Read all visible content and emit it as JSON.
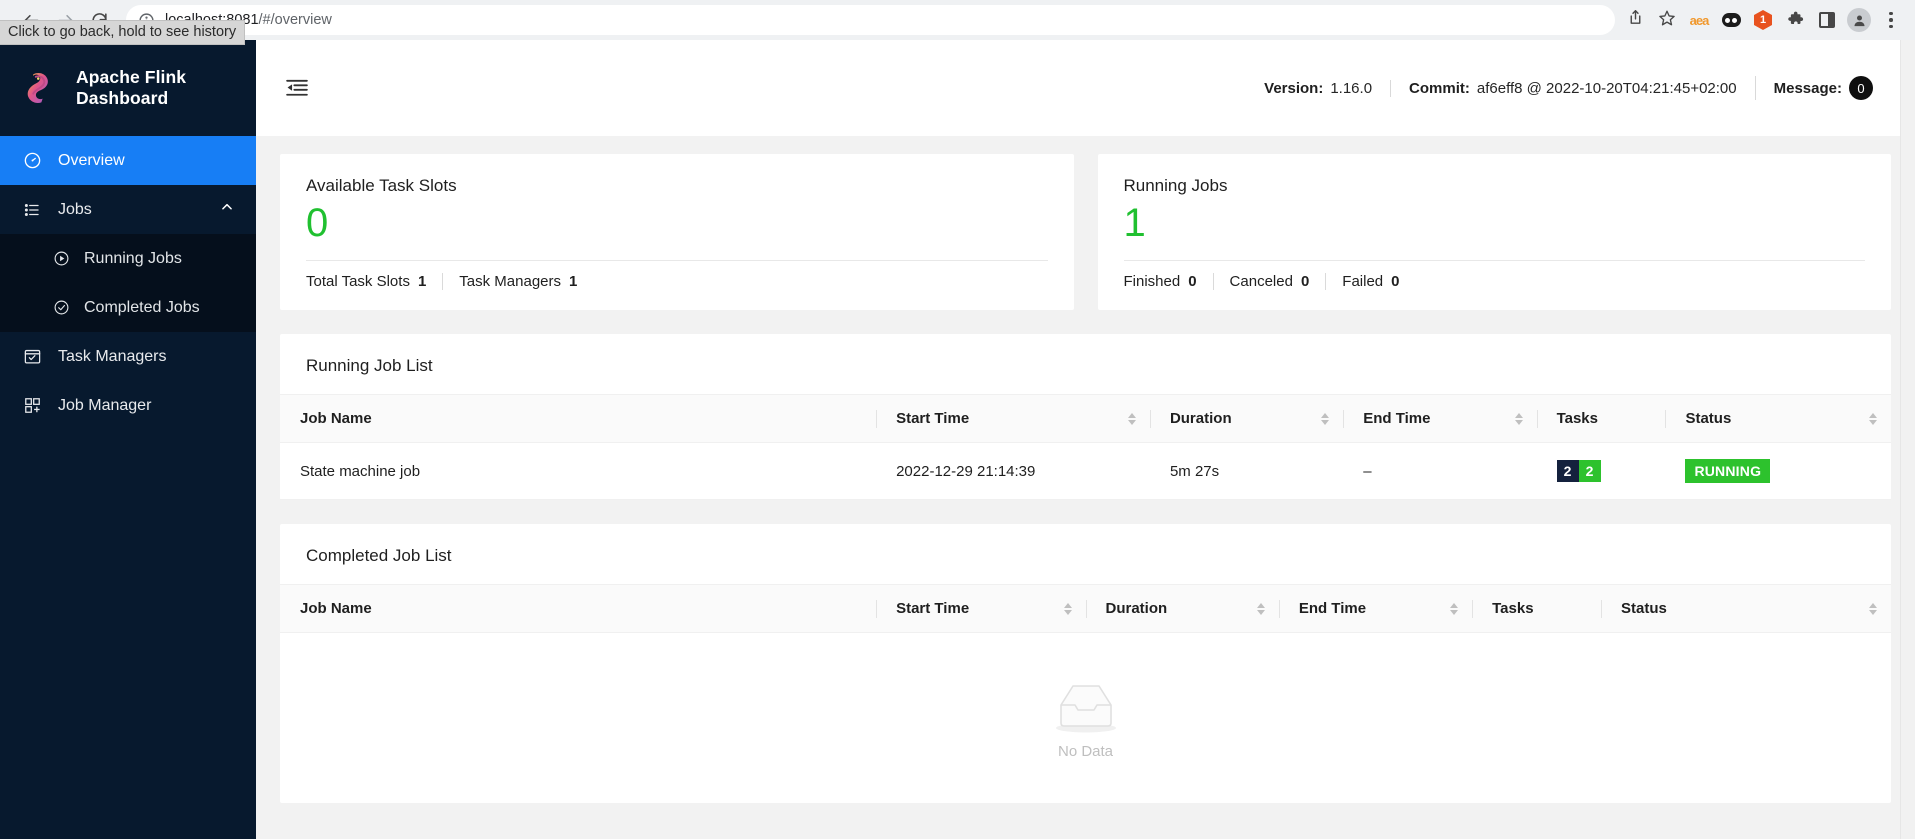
{
  "browser": {
    "url_host": "localhost:8081",
    "url_path": "/#/overview",
    "tooltip": "Click to go back, hold to see history",
    "back_icon": "back-arrow-icon",
    "forward_icon": "forward-arrow-icon",
    "reload_icon": "reload-icon",
    "info_icon": "site-info-icon",
    "share_icon": "share-icon",
    "bookmark_icon": "star-icon",
    "ext_aea_label": "aea",
    "ext_hex_label": "1",
    "kebab_icon": "more-options-icon"
  },
  "sidebar": {
    "brand": "Apache Flink Dashboard",
    "items": [
      {
        "label": "Overview",
        "icon": "dashboard-icon",
        "active": true
      },
      {
        "label": "Jobs",
        "icon": "list-icon",
        "expanded": true,
        "chevron": "chevron-up-icon"
      },
      {
        "label": "Running Jobs",
        "icon": "play-circle-icon",
        "sub": true
      },
      {
        "label": "Completed Jobs",
        "icon": "check-circle-icon",
        "sub": true
      },
      {
        "label": "Task Managers",
        "icon": "task-manager-icon"
      },
      {
        "label": "Job Manager",
        "icon": "job-manager-icon"
      }
    ]
  },
  "topbar": {
    "menu_fold_icon": "menu-fold-icon",
    "version_label": "Version:",
    "version_value": "1.16.0",
    "commit_label": "Commit:",
    "commit_value": "af6eff8 @ 2022-10-20T04:21:45+02:00",
    "message_label": "Message:",
    "message_count": "0"
  },
  "cards": [
    {
      "title": "Available Task Slots",
      "value": "0",
      "value_color": "#20c030",
      "footer": [
        {
          "label": "Total Task Slots",
          "value": "1"
        },
        {
          "label": "Task Managers",
          "value": "1"
        }
      ]
    },
    {
      "title": "Running Jobs",
      "value": "1",
      "value_color": "#20c030",
      "footer": [
        {
          "label": "Finished",
          "value": "0"
        },
        {
          "label": "Canceled",
          "value": "0"
        },
        {
          "label": "Failed",
          "value": "0"
        }
      ]
    }
  ],
  "running_job_list": {
    "title": "Running Job List",
    "columns": [
      {
        "label": "Job Name",
        "sortable": false
      },
      {
        "label": "Start Time",
        "sortable": true
      },
      {
        "label": "Duration",
        "sortable": true
      },
      {
        "label": "End Time",
        "sortable": true
      },
      {
        "label": "Tasks",
        "sortable": false
      },
      {
        "label": "Status",
        "sortable": true
      }
    ],
    "rows": [
      {
        "job_name": "State machine job",
        "start_time": "2022-12-29 21:14:39",
        "duration": "5m 27s",
        "end_time": "–",
        "tasks": [
          {
            "value": "2",
            "color": "#14213d"
          },
          {
            "value": "2",
            "color": "#2dc22d"
          }
        ],
        "status": "RUNNING",
        "status_color": "#2dc22d"
      }
    ]
  },
  "completed_job_list": {
    "title": "Completed Job List",
    "columns": [
      {
        "label": "Job Name",
        "sortable": false
      },
      {
        "label": "Start Time",
        "sortable": true
      },
      {
        "label": "Duration",
        "sortable": true
      },
      {
        "label": "End Time",
        "sortable": true
      },
      {
        "label": "Tasks",
        "sortable": false
      },
      {
        "label": "Status",
        "sortable": true
      }
    ],
    "rows": [],
    "empty_text": "No Data",
    "empty_icon": "empty-inbox-icon"
  }
}
